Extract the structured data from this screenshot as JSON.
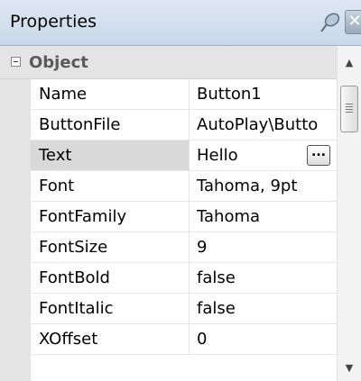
{
  "panel": {
    "title": "Properties",
    "icons": {
      "pin": "pin-icon",
      "close": "close-icon"
    },
    "close_glyph": "✕"
  },
  "category": {
    "label": "Object",
    "expanded": true
  },
  "properties": [
    {
      "name": "Name",
      "value": "Button1",
      "selected": false
    },
    {
      "name": "ButtonFile",
      "value": "AutoPlay\\Butto",
      "selected": false
    },
    {
      "name": "Text",
      "value": "Hello",
      "selected": true,
      "has_ellipsis": true,
      "ellipsis_label": "..."
    },
    {
      "name": "Font",
      "value": "Tahoma, 9pt",
      "selected": false
    },
    {
      "name": "FontFamily",
      "value": "Tahoma",
      "selected": false
    },
    {
      "name": "FontSize",
      "value": "9",
      "selected": false
    },
    {
      "name": "FontBold",
      "value": "false",
      "selected": false
    },
    {
      "name": "FontItalic",
      "value": "false",
      "selected": false
    },
    {
      "name": "XOffset",
      "value": "0",
      "selected": false
    }
  ],
  "scrollbar": {
    "up_glyph": "▲",
    "down_glyph": "▼"
  },
  "colors": {
    "titlebar": "#c9d7e8",
    "category_bg": "#e4e4e4",
    "selected_row": "#d9d9d9"
  }
}
